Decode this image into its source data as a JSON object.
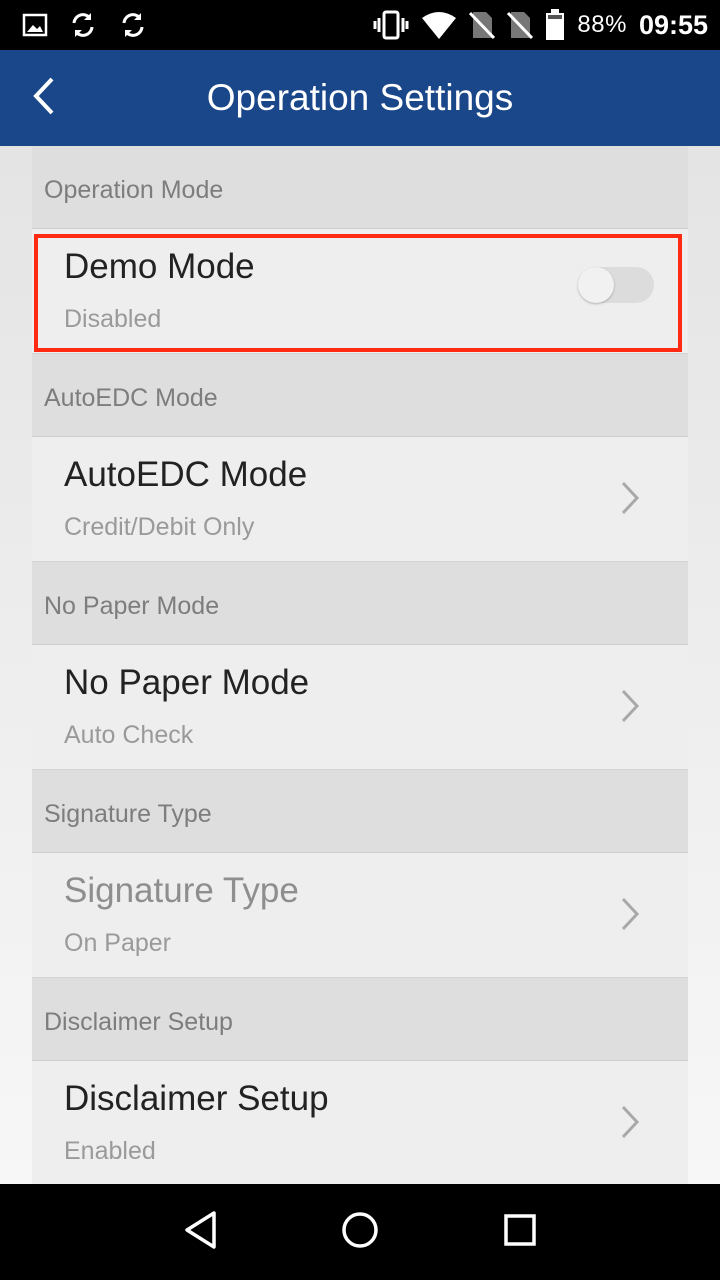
{
  "status_bar": {
    "battery_percent": "88%",
    "time": "09:55",
    "icons": [
      "image-icon",
      "sync-icon",
      "sync-icon",
      "vibrate-icon",
      "wifi-icon",
      "no-sim-icon",
      "no-sim-icon",
      "battery-icon"
    ]
  },
  "app_bar": {
    "title": "Operation Settings"
  },
  "sections": [
    {
      "header": "Operation Mode",
      "item_title": "Demo Mode",
      "item_sub": "Disabled",
      "control": "toggle",
      "toggle_on": false
    },
    {
      "header": "AutoEDC Mode",
      "item_title": "AutoEDC Mode",
      "item_sub": "Credit/Debit Only",
      "control": "chevron"
    },
    {
      "header": "No Paper Mode",
      "item_title": "No Paper Mode",
      "item_sub": "Auto Check",
      "control": "chevron"
    },
    {
      "header": "Signature Type",
      "item_title": "Signature Type",
      "item_sub": "On Paper",
      "control": "chevron",
      "disabled": true
    },
    {
      "header": "Disclaimer Setup",
      "item_title": "Disclaimer Setup",
      "item_sub": "Enabled",
      "control": "chevron"
    }
  ],
  "colors": {
    "app_bar": "#1a4789",
    "highlight": "#ff2a12"
  }
}
